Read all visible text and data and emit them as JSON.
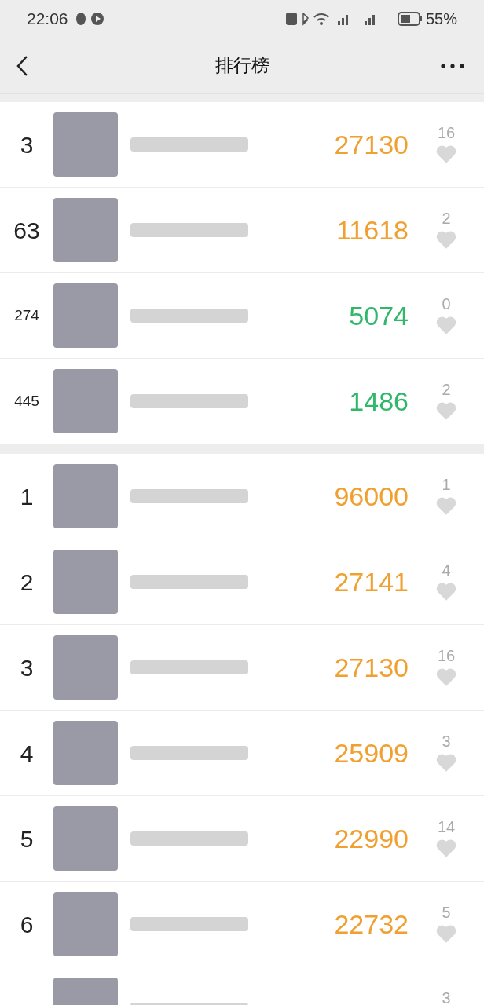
{
  "status_bar": {
    "time": "22:06",
    "battery": "55%"
  },
  "header": {
    "title": "排行榜"
  },
  "sections": [
    {
      "rows": [
        {
          "rank": "3",
          "steps": "27130",
          "color": "#f0a030",
          "likes": "16"
        },
        {
          "rank": "63",
          "steps": "11618",
          "color": "#f0a030",
          "likes": "2"
        },
        {
          "rank": "274",
          "steps": "5074",
          "color": "#2fb86a",
          "likes": "0"
        },
        {
          "rank": "445",
          "steps": "1486",
          "color": "#2fb86a",
          "likes": "2"
        }
      ]
    },
    {
      "rows": [
        {
          "rank": "1",
          "steps": "96000",
          "color": "#f0a030",
          "likes": "1"
        },
        {
          "rank": "2",
          "steps": "27141",
          "color": "#f0a030",
          "likes": "4"
        },
        {
          "rank": "3",
          "steps": "27130",
          "color": "#f0a030",
          "likes": "16"
        },
        {
          "rank": "4",
          "steps": "25909",
          "color": "#f0a030",
          "likes": "3"
        },
        {
          "rank": "5",
          "steps": "22990",
          "color": "#f0a030",
          "likes": "14"
        },
        {
          "rank": "6",
          "steps": "22732",
          "color": "#f0a030",
          "likes": "5"
        },
        {
          "likes": "3"
        }
      ]
    }
  ]
}
